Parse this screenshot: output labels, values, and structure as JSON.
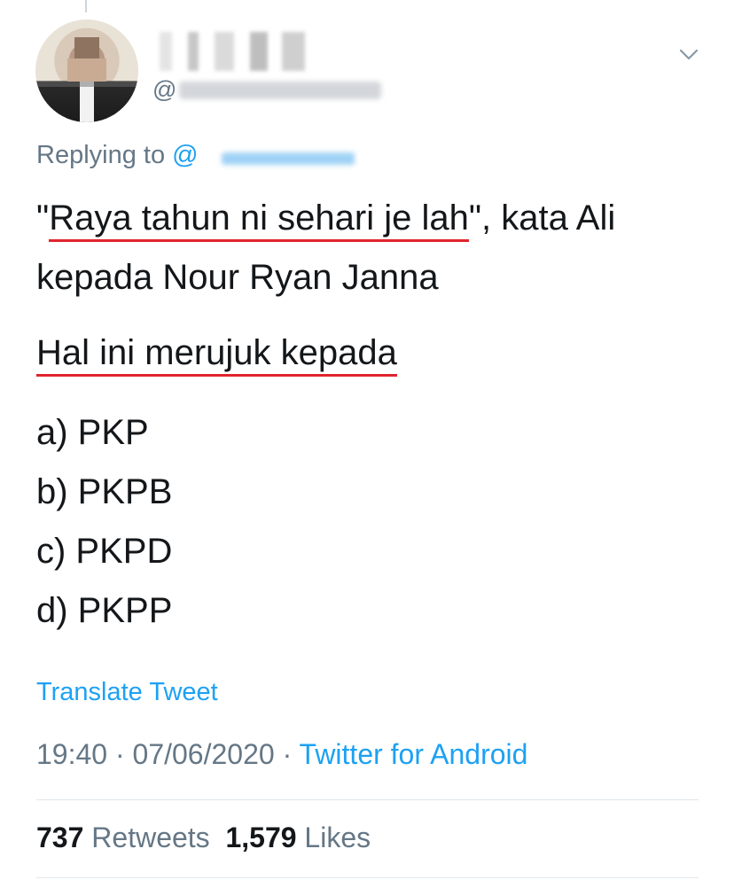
{
  "tweet": {
    "handle_prefix": "@",
    "replying_label": "Replying to",
    "replying_at": "@",
    "text": {
      "line1_open_quote": "\"",
      "line1_underlined": "Raya tahun ni sehari je lah",
      "line1_rest": "\", kata Ali",
      "line2": "kepada Nour Ryan Janna",
      "line3_underlined": "Hal ini merujuk kepada"
    },
    "options": [
      "a) PKP",
      "b) PKPB",
      "c) PKPD",
      "d) PKPP"
    ],
    "translate_label": "Translate Tweet",
    "time": "19:40",
    "date": "07/06/2020",
    "separator": "·",
    "source": "Twitter for Android",
    "retweets_count": "737",
    "retweets_label": "Retweets",
    "likes_count": "1,579",
    "likes_label": "Likes"
  },
  "colors": {
    "accent": "#1da1f2",
    "underline": "#e0242c",
    "secondary_text": "#657786",
    "primary_text": "#14171a"
  },
  "icons": {
    "menu": "chevron-down-icon"
  }
}
